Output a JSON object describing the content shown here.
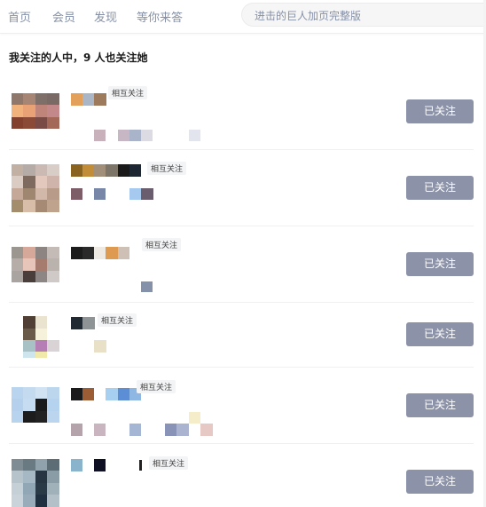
{
  "nav": {
    "items": [
      "首页",
      "会员",
      "发现",
      "等你来答"
    ],
    "search_placeholder": "进击的巨人加页完整版"
  },
  "page_title": "我关注的人中，9 人也关注她",
  "users": [
    {
      "tag": "相互关注",
      "button": "已关注"
    },
    {
      "tag": "相互关注",
      "button": "已关注"
    },
    {
      "tag": "相互关注",
      "button": "已关注"
    },
    {
      "tag": "相互关注",
      "button": "已关注"
    },
    {
      "tag": "相互关注",
      "button": "已关注"
    },
    {
      "tag": "相互关注",
      "button": "已关注"
    }
  ],
  "colors": {
    "follow_button_bg": "#8c93a8",
    "nav_text": "#8590a6",
    "tag_bg": "#f3f4f6"
  }
}
